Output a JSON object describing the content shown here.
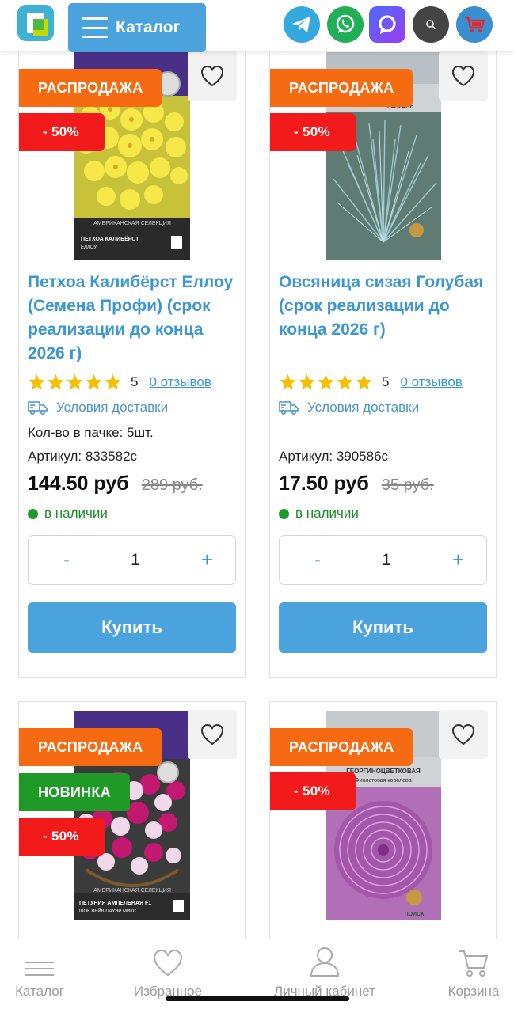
{
  "header": {
    "catalog_label": "Каталог",
    "icons": [
      "telegram-icon",
      "whatsapp-icon",
      "max-messenger-icon",
      "search-icon",
      "cart-icon"
    ]
  },
  "colors": {
    "accent": "#4aa3dc",
    "sale_badge": "#f66a12",
    "discount_badge": "#f21a1a",
    "new_badge": "#1f9a26",
    "title_link": "#3a97d2",
    "star": "#f6c000",
    "in_stock": "#1d9a2a"
  },
  "products": [
    {
      "badges": {
        "sale": "РАСПРОДАЖА",
        "discount": "- 50%"
      },
      "title": "Петхоа Калибёрст Еллоу (Семена Профи) (срок реализации до конца 2026 г)",
      "rating": 5,
      "rating_text": "5",
      "reviews_text": "0 отзывов",
      "delivery_text": "Условия доставки",
      "pack_text": "Кол-во в пачке: 5шт.",
      "sku_text": "Артикул: 833582с",
      "price": "144.50 руб",
      "old_price": "289 руб.",
      "stock_text": "в наличии",
      "quantity": "1",
      "minus_label": "-",
      "plus_label": "+",
      "buy_label": "Купить",
      "package_caption": "ПЕТХОА КАЛИБЁРСТ ЕЛЛОУ",
      "package_series": "АМЕРИКАНСКАЯ СЕЛЕКЦИЯ"
    },
    {
      "badges": {
        "sale": "РАСПРОДАЖА",
        "discount": "- 50%"
      },
      "title": "Овсяница сизая Голубая (срок реализации до конца 2026 г)",
      "rating": 5,
      "rating_text": "5",
      "reviews_text": "0 отзывов",
      "delivery_text": "Условия доставки",
      "sku_text": "Артикул: 390586с",
      "price": "17.50 руб",
      "old_price": "35 руб.",
      "stock_text": "в наличии",
      "quantity": "1",
      "minus_label": "-",
      "plus_label": "+",
      "buy_label": "Купить",
      "package_caption": "ГОЛУБАЯ"
    },
    {
      "badges": {
        "sale": "РАСПРОДАЖА",
        "new": "НОВИНКА",
        "discount": "- 50%"
      },
      "package_caption": "ПЕТУНИЯ АМПЕЛЬНАЯ F1 ШОК ВЕЙВ ПАУЭР МИКС",
      "package_series": "АМЕРИКАНСКАЯ СЕЛЕКЦИЯ"
    },
    {
      "badges": {
        "sale": "РАСПРОДАЖА",
        "discount": "- 50%"
      },
      "package_caption": "ГЕОРГИНОЦВЕТКОВАЯ",
      "package_subcaption": "Фиолетовая королева",
      "package_brand": "ПОИСК"
    }
  ],
  "bottom_nav": [
    {
      "label": "Каталог",
      "icon": "menu-icon"
    },
    {
      "label": "Избранное",
      "icon": "heart-icon"
    },
    {
      "label": "Личный кабинет",
      "icon": "user-icon"
    },
    {
      "label": "Корзина",
      "icon": "cart-icon"
    }
  ]
}
